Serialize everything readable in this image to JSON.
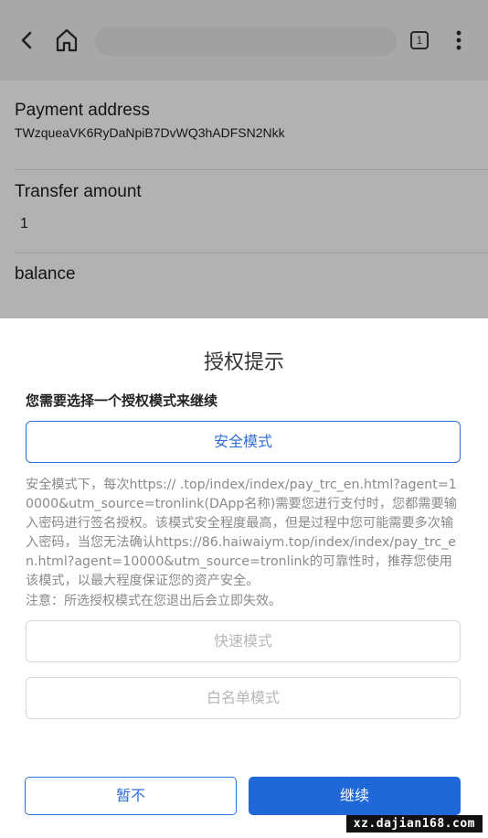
{
  "browser": {
    "tab_count": "1",
    "icons": [
      "back-icon",
      "home-icon",
      "tabs-icon",
      "more-vert-icon"
    ]
  },
  "page": {
    "payment_address_label": "Payment address",
    "payment_address_value": "TWzqueaVK6RyDaNpiB7DvWQ3hADFSN2Nkk",
    "transfer_amount_label": "Transfer amount",
    "transfer_amount_value": "1",
    "balance_label": "balance"
  },
  "dialog": {
    "title": "授权提示",
    "subtitle": "您需要选择一个授权模式来继续",
    "safe_mode_label": "安全模式",
    "description": "安全模式下，每次https://          .top/index/index/pay_trc_en.html?agent=10000&utm_source=tronlink(DApp名称)需要您进行支付时，您都需要输入密码进行签名授权。该模式安全程度最高，但是过程中您可能需要多次输入密码，当您无法确认https://86.haiwaiym.top/index/index/pay_trc_en.html?agent=10000&utm_source=tronlink的可靠性时，推荐您使用该模式，以最大程度保证您的资产安全。",
    "note": "注意：所选授权模式在您退出后会立即失效。",
    "fast_mode_label": "快速模式",
    "whitelist_mode_label": "白名单模式",
    "cancel_label": "暂不",
    "continue_label": "继续"
  },
  "watermark": "xz.dajian168.com",
  "colors": {
    "accent": "#2f6fd6",
    "continue_bg": "#2067d8",
    "muted_text": "#8a8a8a",
    "disabled_border": "#d6d6d6"
  }
}
